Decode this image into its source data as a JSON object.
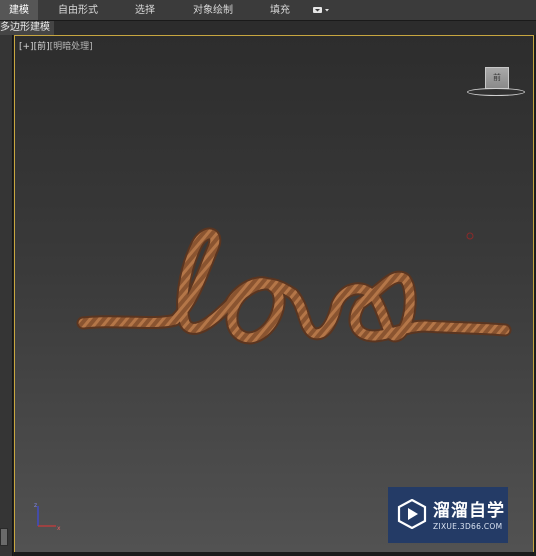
{
  "ribbon": {
    "tabs": [
      {
        "label": "建模",
        "active": true
      },
      {
        "label": "自由形式",
        "active": false
      },
      {
        "label": "选择",
        "active": false
      },
      {
        "label": "对象绘制",
        "active": false
      },
      {
        "label": "填充",
        "active": false
      }
    ],
    "dropdown_icon": "display-dropdown-icon"
  },
  "subbar": {
    "active_panel": "多边形建模"
  },
  "viewport": {
    "labels": {
      "plus": "[+]",
      "view": "[前]",
      "shading": "[明暗处理]"
    },
    "viewcube_face": "前",
    "scene_object": "rope text love",
    "accent": "#c7a640"
  },
  "watermark": {
    "title": "溜溜自学",
    "url": "ZIXUE.3D66.COM",
    "bg": "#243b66"
  }
}
